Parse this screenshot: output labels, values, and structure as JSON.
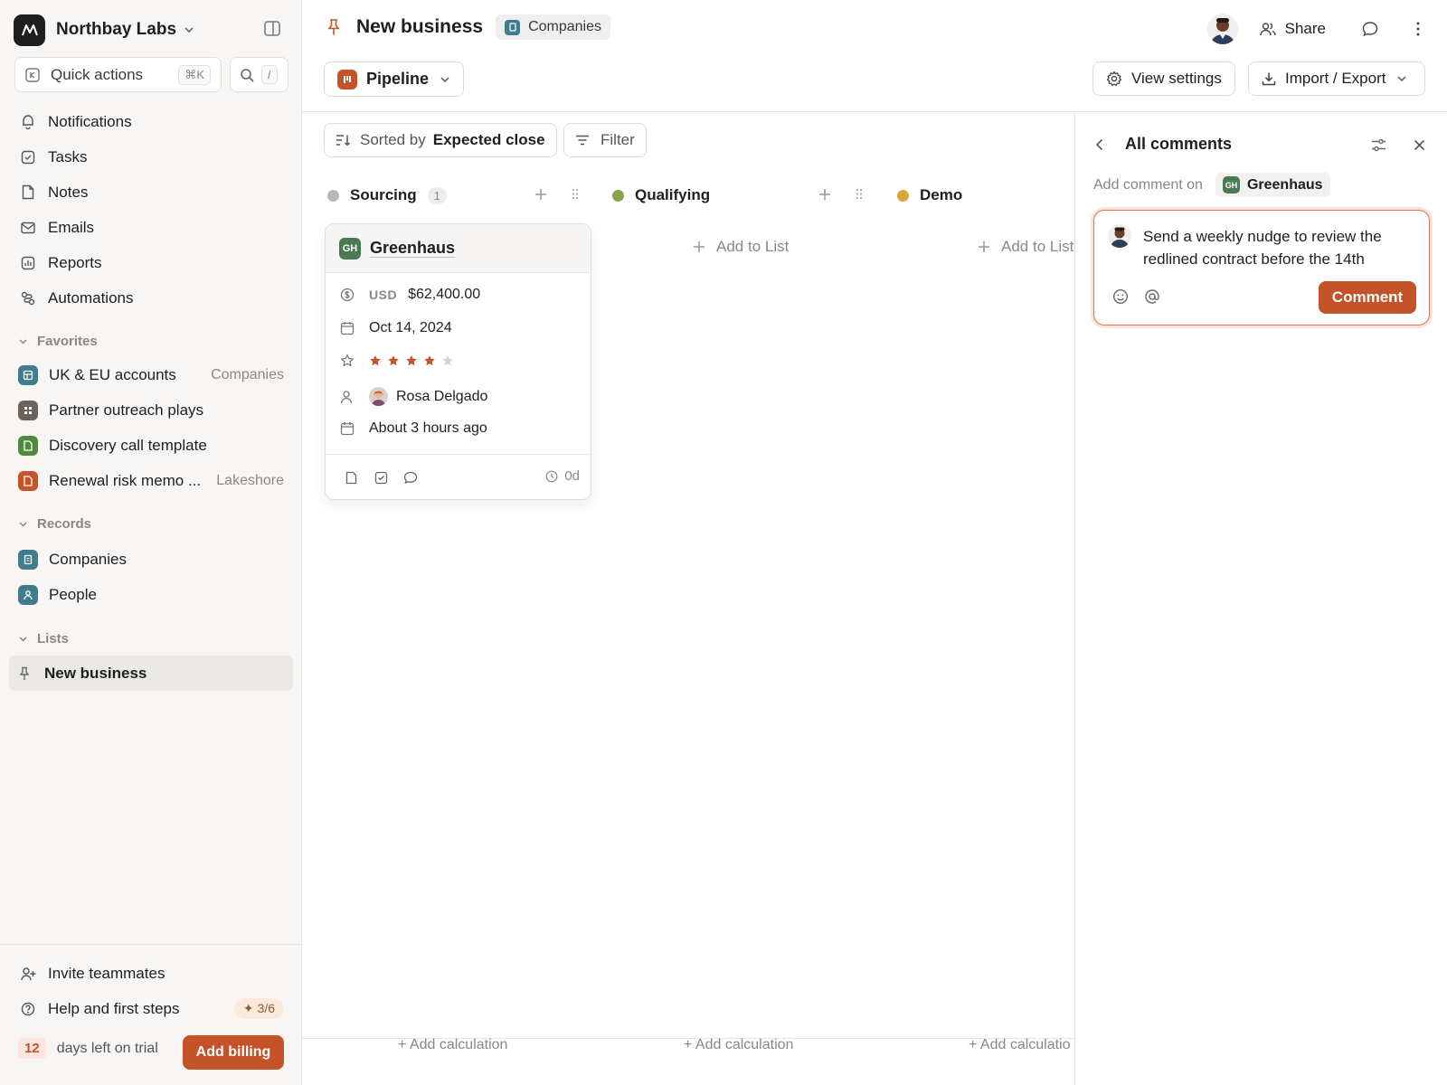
{
  "workspace": {
    "name": "Northbay Labs"
  },
  "sidebar": {
    "quick_actions": {
      "label": "Quick actions",
      "shortcut": "⌘K"
    },
    "search_shortcut": "/",
    "nav": [
      {
        "label": "Notifications",
        "icon": "bell-icon"
      },
      {
        "label": "Tasks",
        "icon": "checkbox-icon"
      },
      {
        "label": "Notes",
        "icon": "document-icon"
      },
      {
        "label": "Emails",
        "icon": "mail-icon"
      },
      {
        "label": "Reports",
        "icon": "chart-icon"
      },
      {
        "label": "Automations",
        "icon": "workflow-icon"
      }
    ],
    "favorites": {
      "title": "Favorites",
      "items": [
        {
          "label": "UK & EU accounts",
          "meta": "Companies",
          "color": "#3f7c8c"
        },
        {
          "label": "Partner outreach plays",
          "meta": "",
          "color": "#6b625b"
        },
        {
          "label": "Discovery call template",
          "meta": "",
          "color": "#4f8a3f"
        },
        {
          "label": "Renewal risk memo ...",
          "meta": "Lakeshore",
          "color": "#c4532a"
        }
      ]
    },
    "records": {
      "title": "Records",
      "items": [
        {
          "label": "Companies",
          "color": "#3f7c8c"
        },
        {
          "label": "People",
          "color": "#3f7c8c"
        }
      ]
    },
    "lists": {
      "title": "Lists",
      "items": [
        {
          "label": "New business"
        }
      ]
    },
    "bottom": {
      "invite": "Invite teammates",
      "help": "Help and first steps",
      "help_progress": "3/6",
      "trial_days": "12",
      "trial_text": "days left on trial",
      "billing_button": "Add billing"
    }
  },
  "header": {
    "title": "New business",
    "object_chip": "Companies",
    "share": "Share",
    "view_name": "Pipeline",
    "view_settings": "View settings",
    "import_export": "Import / Export"
  },
  "toolbar": {
    "sorted_prefix": "Sorted by",
    "sorted_field": "Expected close",
    "filter": "Filter"
  },
  "board": {
    "columns": [
      {
        "name": "Sourcing",
        "count": "1",
        "color": "#b9b6b3",
        "add_calc": "+ Add calculation"
      },
      {
        "name": "Qualifying",
        "count": "",
        "color": "#8aa34a",
        "add_list": "Add to List",
        "add_calc": "+ Add calculation"
      },
      {
        "name": "Demo",
        "count": "",
        "color": "#d9a63a",
        "add_list": "Add to List",
        "add_calc": "+ Add calculatio"
      }
    ],
    "card": {
      "initials": "GH",
      "title": "Greenhaus",
      "currency": "USD",
      "amount": "$62,400.00",
      "date": "Oct 14, 2024",
      "rating": 4,
      "rating_max": 5,
      "owner": "Rosa Delgado",
      "updated": "About 3 hours ago",
      "age": "0d"
    }
  },
  "comments": {
    "title": "All comments",
    "add_on_label": "Add comment on",
    "target_initials": "GH",
    "target": "Greenhaus",
    "draft": "Send a weekly nudge to review the redlined contract before the 14th",
    "submit": "Comment"
  },
  "colors": {
    "accent": "#c4532a"
  }
}
